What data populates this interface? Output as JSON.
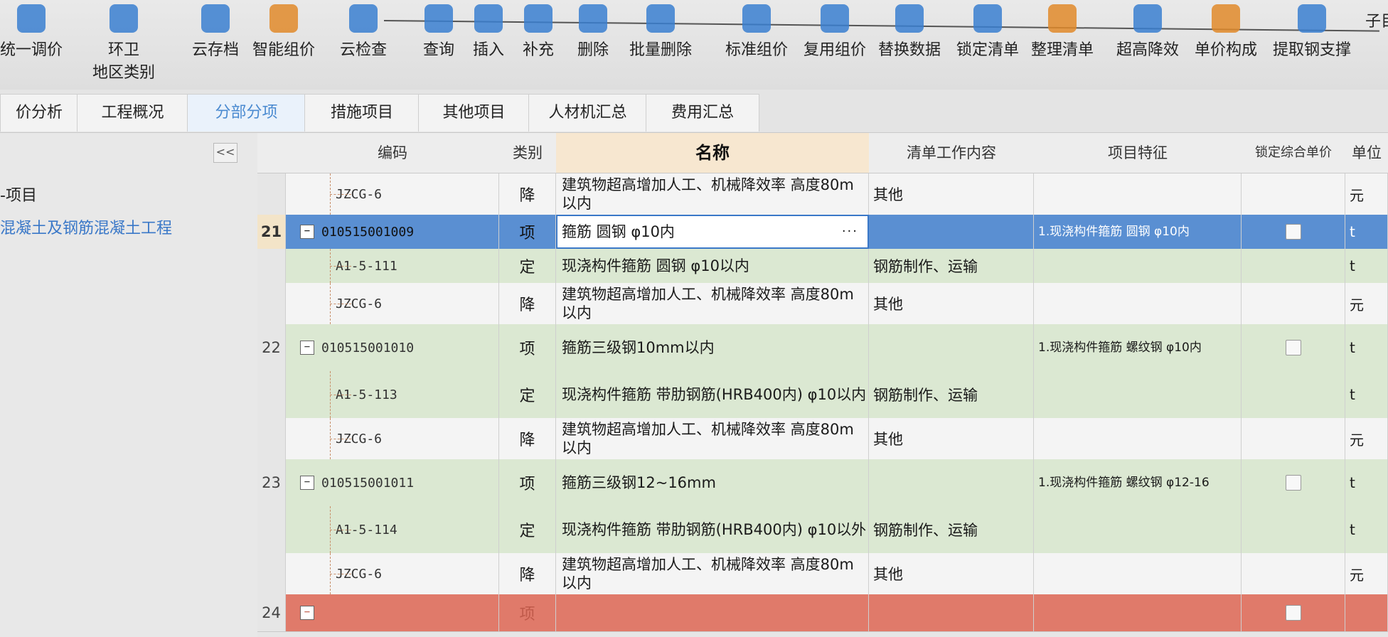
{
  "toolbar": {
    "items": [
      {
        "label": "统一调价",
        "icon": "adjust-price-icon"
      },
      {
        "label": "环卫",
        "label2": "地区类别",
        "icon": "region-category-icon"
      },
      {
        "label": "云存档",
        "icon": "cloud-save-icon"
      },
      {
        "label": "智能组价",
        "icon": "smart-pricing-icon"
      },
      {
        "label": "云检查",
        "icon": "cloud-check-icon"
      },
      {
        "label": "查询",
        "icon": "query-icon"
      },
      {
        "label": "插入",
        "icon": "insert-icon"
      },
      {
        "label": "补充",
        "icon": "supplement-icon"
      },
      {
        "label": "删除",
        "icon": "delete-icon"
      },
      {
        "label": "批量删除",
        "icon": "batch-delete-icon"
      },
      {
        "label": "标准组价",
        "icon": "standard-pricing-icon"
      },
      {
        "label": "复用组价",
        "icon": "reuse-pricing-icon"
      },
      {
        "label": "替换数据",
        "icon": "replace-data-icon"
      },
      {
        "label": "锁定清单",
        "icon": "lock-list-icon"
      },
      {
        "label": "整理清单",
        "icon": "organize-list-icon"
      },
      {
        "label": "超高降效",
        "icon": "height-efficiency-icon"
      },
      {
        "label": "单价构成",
        "icon": "unit-price-icon"
      },
      {
        "label": "提取钢支撑",
        "icon": "steel-support-icon"
      },
      {
        "label": "子目",
        "icon": ""
      }
    ]
  },
  "tabs": [
    "价分析",
    "工程概况",
    "分部分项",
    "措施项目",
    "其他项目",
    "人材机汇总",
    "费用汇总"
  ],
  "active_tab": "分部分项",
  "left_panel": {
    "collapse_label": "<<",
    "tree_root": "-项目",
    "tree_item": "混凝土及钢筋混凝土工程"
  },
  "grid": {
    "headers": {
      "code": "编码",
      "type": "类别",
      "name": "名称",
      "work": "清单工作内容",
      "feature": "项目特征",
      "lock": "锁定综合单价",
      "unit": "单位"
    },
    "rows": [
      {
        "num": "",
        "code": "JZCG-6",
        "type": "降",
        "name": "建筑物超高增加人工、机械降效率 高度80m以内",
        "work": "其他",
        "feature": "",
        "unit": "元",
        "style": "white",
        "sub": true
      },
      {
        "num": "21",
        "code": "010515001009",
        "type": "项",
        "name": "箍筋 圆钢 φ10内",
        "work": "",
        "feature": "1.现浇构件箍筋 圆钢 φ10内",
        "unit": "t",
        "style": "sel",
        "sub": false,
        "dots": "···"
      },
      {
        "num": "",
        "code": "A1-5-111",
        "type": "定",
        "name": "现浇构件箍筋 圆钢 φ10以内",
        "work": "钢筋制作、运输",
        "feature": "",
        "unit": "t",
        "style": "green",
        "sub": true
      },
      {
        "num": "",
        "code": "JZCG-6",
        "type": "降",
        "name": "建筑物超高增加人工、机械降效率 高度80m以内",
        "work": "其他",
        "feature": "",
        "unit": "元",
        "style": "white",
        "sub": true
      },
      {
        "num": "22",
        "code": "010515001010",
        "type": "项",
        "name": "箍筋三级钢10mm以内",
        "work": "",
        "feature": "1.现浇构件箍筋 螺纹钢 φ10内",
        "unit": "t",
        "style": "green",
        "sub": false
      },
      {
        "num": "",
        "code": "A1-5-113",
        "type": "定",
        "name": "现浇构件箍筋 带肋钢筋(HRB400内) φ10以内",
        "work": "钢筋制作、运输",
        "feature": "",
        "unit": "t",
        "style": "green",
        "sub": true
      },
      {
        "num": "",
        "code": "JZCG-6",
        "type": "降",
        "name": "建筑物超高增加人工、机械降效率 高度80m以内",
        "work": "其他",
        "feature": "",
        "unit": "元",
        "style": "white",
        "sub": true
      },
      {
        "num": "23",
        "code": "010515001011",
        "type": "项",
        "name": "箍筋三级钢12~16mm",
        "work": "",
        "feature": "1.现浇构件箍筋 螺纹钢 φ12-16",
        "unit": "t",
        "style": "green",
        "sub": false
      },
      {
        "num": "",
        "code": "A1-5-114",
        "type": "定",
        "name": "现浇构件箍筋 带肋钢筋(HRB400内) φ10以外",
        "work": "钢筋制作、运输",
        "feature": "",
        "unit": "t",
        "style": "green",
        "sub": true
      },
      {
        "num": "",
        "code": "JZCG-6",
        "type": "降",
        "name": "建筑物超高增加人工、机械降效率 高度80m以内",
        "work": "其他",
        "feature": "",
        "unit": "元",
        "style": "white",
        "sub": true
      },
      {
        "num": "24",
        "code": "",
        "type": "项",
        "name": "",
        "work": "",
        "feature": "",
        "unit": "",
        "style": "red",
        "sub": false
      }
    ]
  },
  "colors": {
    "accent": "#4a8ad0",
    "selected_row": "#5a8fd2",
    "green_row": "#dbe8d2",
    "red_row": "#e07a6a"
  }
}
